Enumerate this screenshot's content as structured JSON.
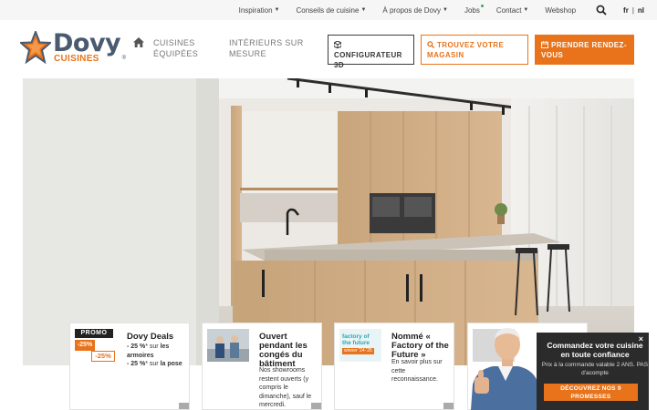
{
  "topnav": {
    "items": [
      {
        "label": "Inspiration",
        "caret": true
      },
      {
        "label": "Conseils de cuisine",
        "caret": true
      },
      {
        "label": "À propos de Dovy",
        "caret": true
      },
      {
        "label": "Jobs",
        "caret": false
      },
      {
        "label": "Contact",
        "caret": true
      },
      {
        "label": "Webshop",
        "caret": false
      }
    ],
    "lang_fr": "fr",
    "lang_sep": "|",
    "lang_nl": "nl"
  },
  "logo": {
    "name": "Dovy",
    "sub": "CUISINES",
    "reg": "®"
  },
  "header": {
    "nav1": "Cuisines équipées",
    "nav2": "Intérieurs sur mesure",
    "btn_config": "Configurateur 3D",
    "btn_store": "Trouvez votre magasin",
    "btn_rdv": "Prendre rendez-vous"
  },
  "cards": {
    "c1": {
      "badge": "PROMO",
      "pct1": "-25%",
      "pct2": "-25%",
      "title": "Dovy Deals",
      "line1a": "- 25 %",
      "line1b": "* sur ",
      "line1c": "les armoires",
      "line2a": "- 25 %",
      "line2b": "* sur ",
      "line2c": "la pose"
    },
    "c2": {
      "title": "Ouvert pendant les congés du bâtiment",
      "body": "Nos showrooms restent ouverts (y compris le dimanche), sauf le mercredi."
    },
    "c3": {
      "thumb_l1": "factory of",
      "thumb_l2": "the future",
      "thumb_l3": "winner '24-'25",
      "title": "Nommé « Factory of the Future »",
      "body": "En savoir plus sur cette reconnaissance."
    }
  },
  "popup": {
    "title": "Commandez votre cuisine en toute confiance",
    "text": "Prix à la commande valable 2 ANS. PAS d'acompte",
    "button": "DÉCOUVREZ NOS 9 PROMESSES",
    "close": "×"
  },
  "colors": {
    "brand_orange": "#e8731a",
    "brand_slate": "#4a5a70",
    "popup_bg": "#2b2b2b"
  },
  "icons": [
    "home-icon",
    "search-icon",
    "cube-icon",
    "magnifier-icon",
    "calendar-icon",
    "close-icon",
    "chevron-right-icon"
  ]
}
